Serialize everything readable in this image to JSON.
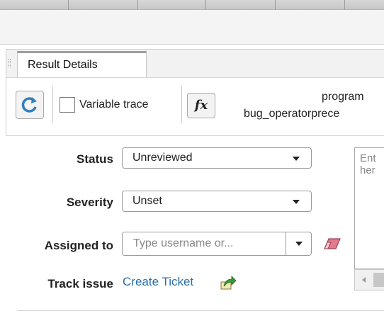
{
  "panel": {
    "tab_label": "Result Details"
  },
  "toolbar": {
    "variable_trace_label": "Variable trace",
    "fx_label": "fx",
    "program_line1": "program",
    "program_line2": "bug_operatorprece"
  },
  "form": {
    "status_label": "Status",
    "status_value": "Unreviewed",
    "severity_label": "Severity",
    "severity_value": "Unset",
    "assigned_label": "Assigned to",
    "assigned_placeholder": "Type username or...",
    "track_label": "Track issue",
    "create_ticket": "Create Ticket"
  },
  "comment": {
    "placeholder": "Ent her"
  },
  "colors": {
    "link": "#2a6fa8",
    "eraser": "#e07a8c"
  },
  "icons": [
    "refresh-icon",
    "fx-icon",
    "eraser-icon",
    "ticket-export-icon",
    "dropdown-arrow-icon"
  ]
}
